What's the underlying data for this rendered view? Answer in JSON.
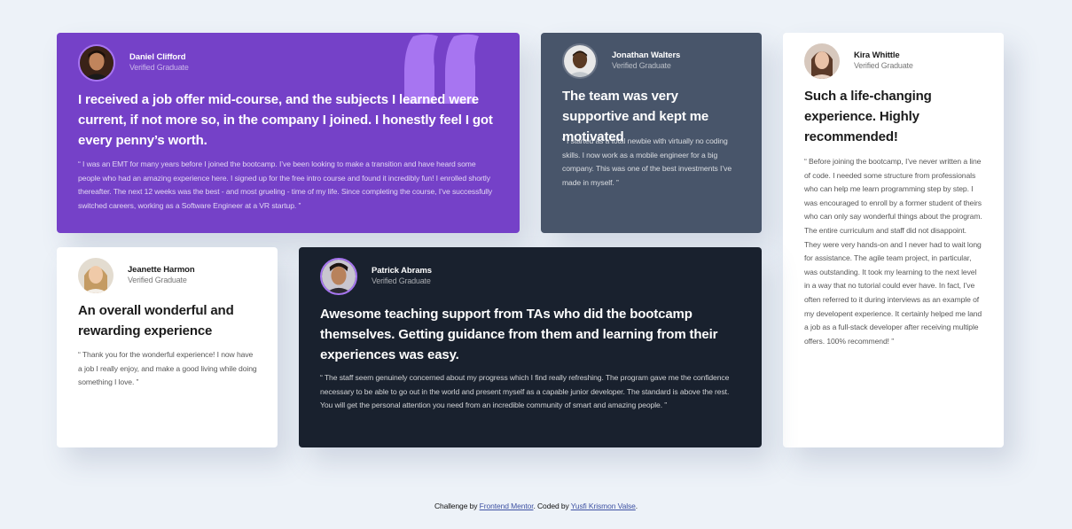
{
  "testimonials": {
    "daniel": {
      "name": "Daniel Clifford",
      "role": "Verified Graduate",
      "headline": "I received a job offer mid-course, and the subjects I learned were current, if not more so, in the company I joined. I honestly feel I got every penny’s worth.",
      "body": "“ I was an EMT for many years before I joined the bootcamp. I’ve been looking to make a transition and have heard some people who had an amazing experience here. I signed up for the free intro course and found it incredibly fun! I enrolled shortly thereafter. The next 12 weeks was the best - and most grueling - time of my life. Since completing the course, I’ve successfully switched careers, working as a Software Engineer at a VR startup. ”",
      "color": "#7541c8"
    },
    "jonathan": {
      "name": "Jonathan Walters",
      "role": "Verified Graduate",
      "headline": "The team was very supportive and kept me motivated",
      "body": "“ I started as a total newbie with virtually no coding skills. I now work as a mobile engineer for a big company. This was one of the best investments I’ve made in myself. ”",
      "color": "#48556a"
    },
    "kira": {
      "name": "Kira Whittle",
      "role": "Verified Graduate",
      "headline": "Such a life-changing experience. Highly recommended!",
      "body": "“ Before joining the bootcamp, I’ve never written a line of code. I needed some structure from professionals who can help me learn programming step by step. I was encouraged to enroll by a former student of theirs who can only say wonderful things about the program. The entire curriculum and staff did not disappoint. They were very hands-on and I never had to wait long for assistance. The agile team project, in particular, was outstanding. It took my learning to the next level in a way that no tutorial could ever have. In fact, I’ve often referred to it during interviews as an example of my developent experience. It certainly helped me land a job as a full-stack developer after receiving multiple offers. 100% recommend! ”",
      "color": "#ffffff"
    },
    "jeanette": {
      "name": "Jeanette Harmon",
      "role": "Verified Graduate",
      "headline": "An overall wonderful and rewarding experience",
      "body": "“ Thank you for the wonderful experience! I now have a job I really enjoy, and make a good living while doing something I love. ”",
      "color": "#ffffff"
    },
    "patrick": {
      "name": "Patrick Abrams",
      "role": "Verified Graduate",
      "headline": "Awesome teaching support from TAs who did the bootcamp themselves. Getting guidance from them and learning from their experiences was easy.",
      "body": "“ The staff seem genuinely concerned about my progress which I find really refreshing. The program gave me the confidence necessary to be able to go out in the world and present myself as a capable junior developer. The standard is above the rest. You will get the personal attention you need from an incredible community of smart and amazing people. ”",
      "color": "#19212e"
    }
  },
  "footer": {
    "prefix": "Challenge by ",
    "link1": "Frontend Mentor",
    "middle": ". Coded by ",
    "link2": "Yusfi Krismon Valse",
    "suffix": "."
  },
  "colors": {
    "background": "#edf2f8",
    "quote_mark": "#a775f1",
    "link": "#3e52a3"
  }
}
